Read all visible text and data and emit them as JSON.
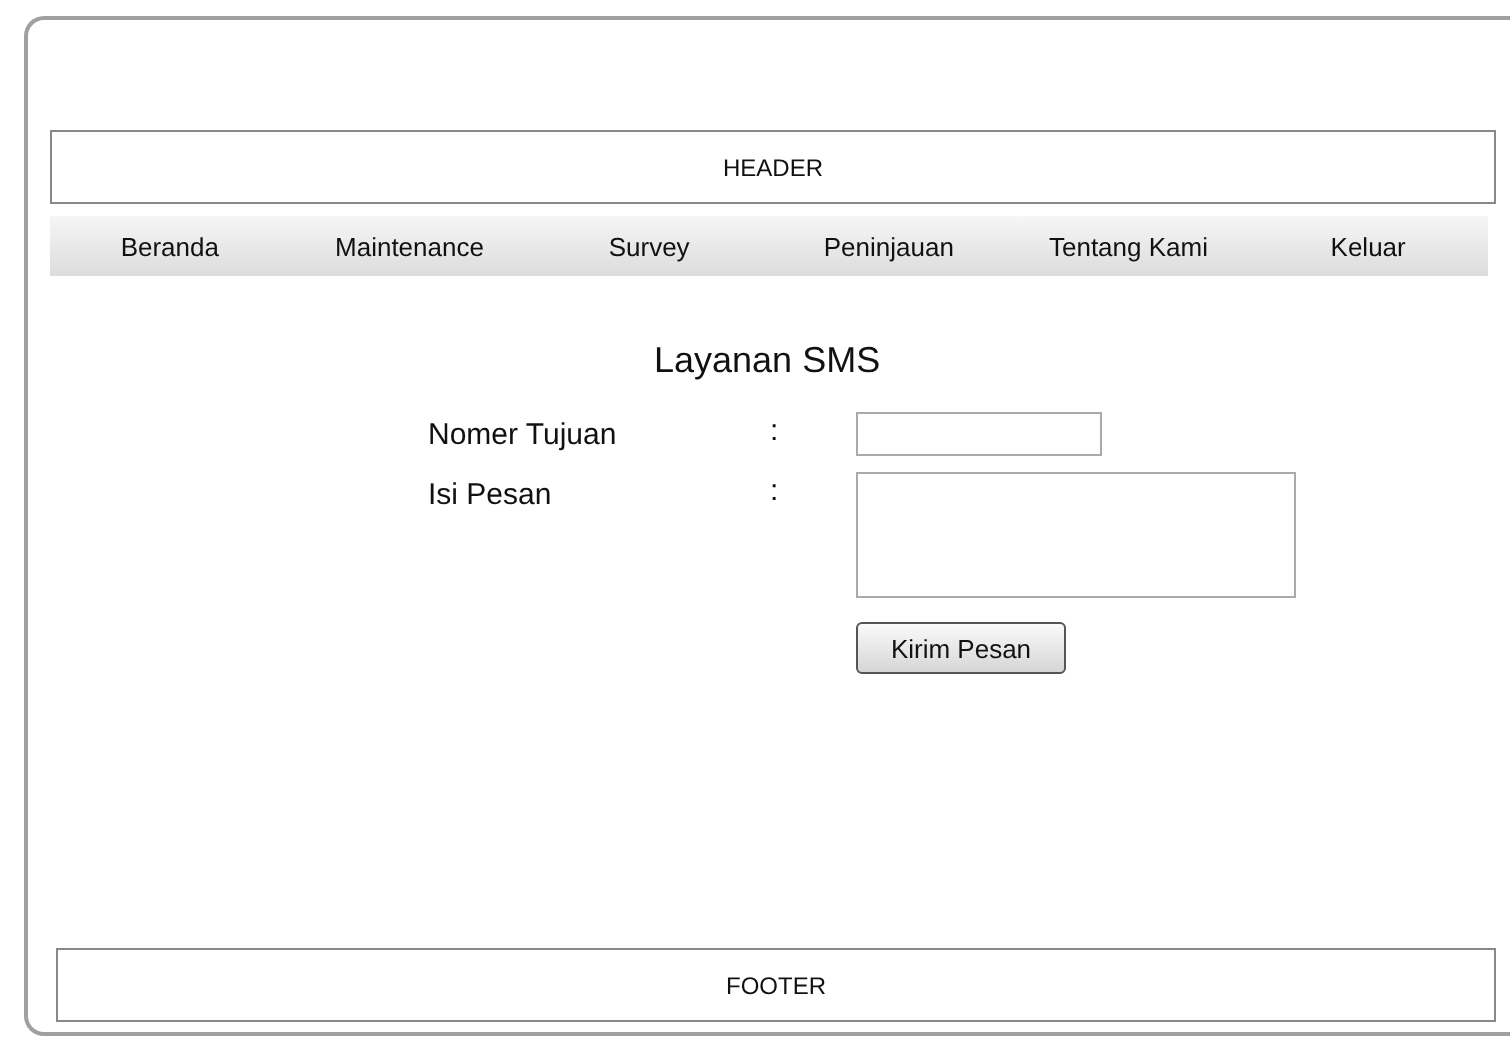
{
  "header": {
    "label": "HEADER"
  },
  "nav": [
    {
      "label": "Beranda"
    },
    {
      "label": "Maintenance"
    },
    {
      "label": "Survey"
    },
    {
      "label": "Peninjauan"
    },
    {
      "label": "Tentang Kami"
    },
    {
      "label": "Keluar"
    }
  ],
  "title": "Layanan SMS",
  "fields": [
    {
      "kind": "text",
      "label": "Nomer Tujuan",
      "separator": ":"
    },
    {
      "kind": "textarea",
      "label": "Isi Pesan",
      "separator": ":"
    }
  ],
  "submit_button": "Kirim Pesan",
  "footer": {
    "label": "FOOTER"
  }
}
